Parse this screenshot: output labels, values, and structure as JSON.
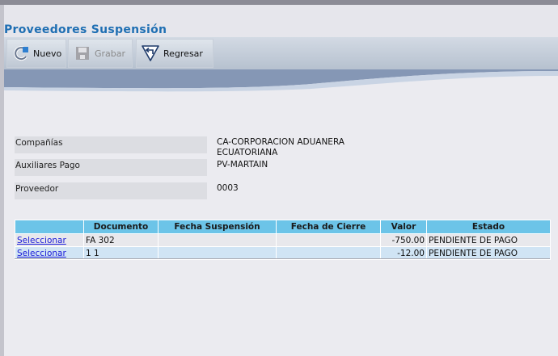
{
  "page_title": "Proveedores Suspensión",
  "toolbar": {
    "nuevo_label": "Nuevo",
    "grabar_label": "Grabar",
    "regresar_label": "Regresar"
  },
  "form": {
    "companias_label": "Compañías",
    "companias_value_line1": "CA-CORPORACION ADUANERA",
    "companias_value_line2": "ECUATORIANA",
    "auxiliares_label": "Auxiliares Pago",
    "auxiliares_value": "PV-MARTAIN",
    "proveedor_label": "Proveedor",
    "proveedor_value": "0003"
  },
  "table": {
    "headers": [
      "",
      "Documento",
      "Fecha Suspensión",
      "Fecha de Cierre",
      "Valor",
      "Estado"
    ],
    "rows": [
      {
        "select": "Seleccionar",
        "documento": "FA 302",
        "fecha_suspension": "",
        "fecha_cierre": "",
        "valor": "-750.00",
        "estado": "PENDIENTE DE PAGO"
      },
      {
        "select": "Seleccionar",
        "documento": "1 1",
        "fecha_suspension": "",
        "fecha_cierre": "",
        "valor": "-12.00",
        "estado": "PENDIENTE DE PAGO"
      }
    ]
  },
  "colors": {
    "title": "#1f6fb3",
    "table_header": "#6cc4e8",
    "row_alt": "#d0e4f4",
    "link": "#1a1ad8"
  },
  "icons": [
    "refresh-icon",
    "save-icon",
    "back-arrow-icon"
  ]
}
